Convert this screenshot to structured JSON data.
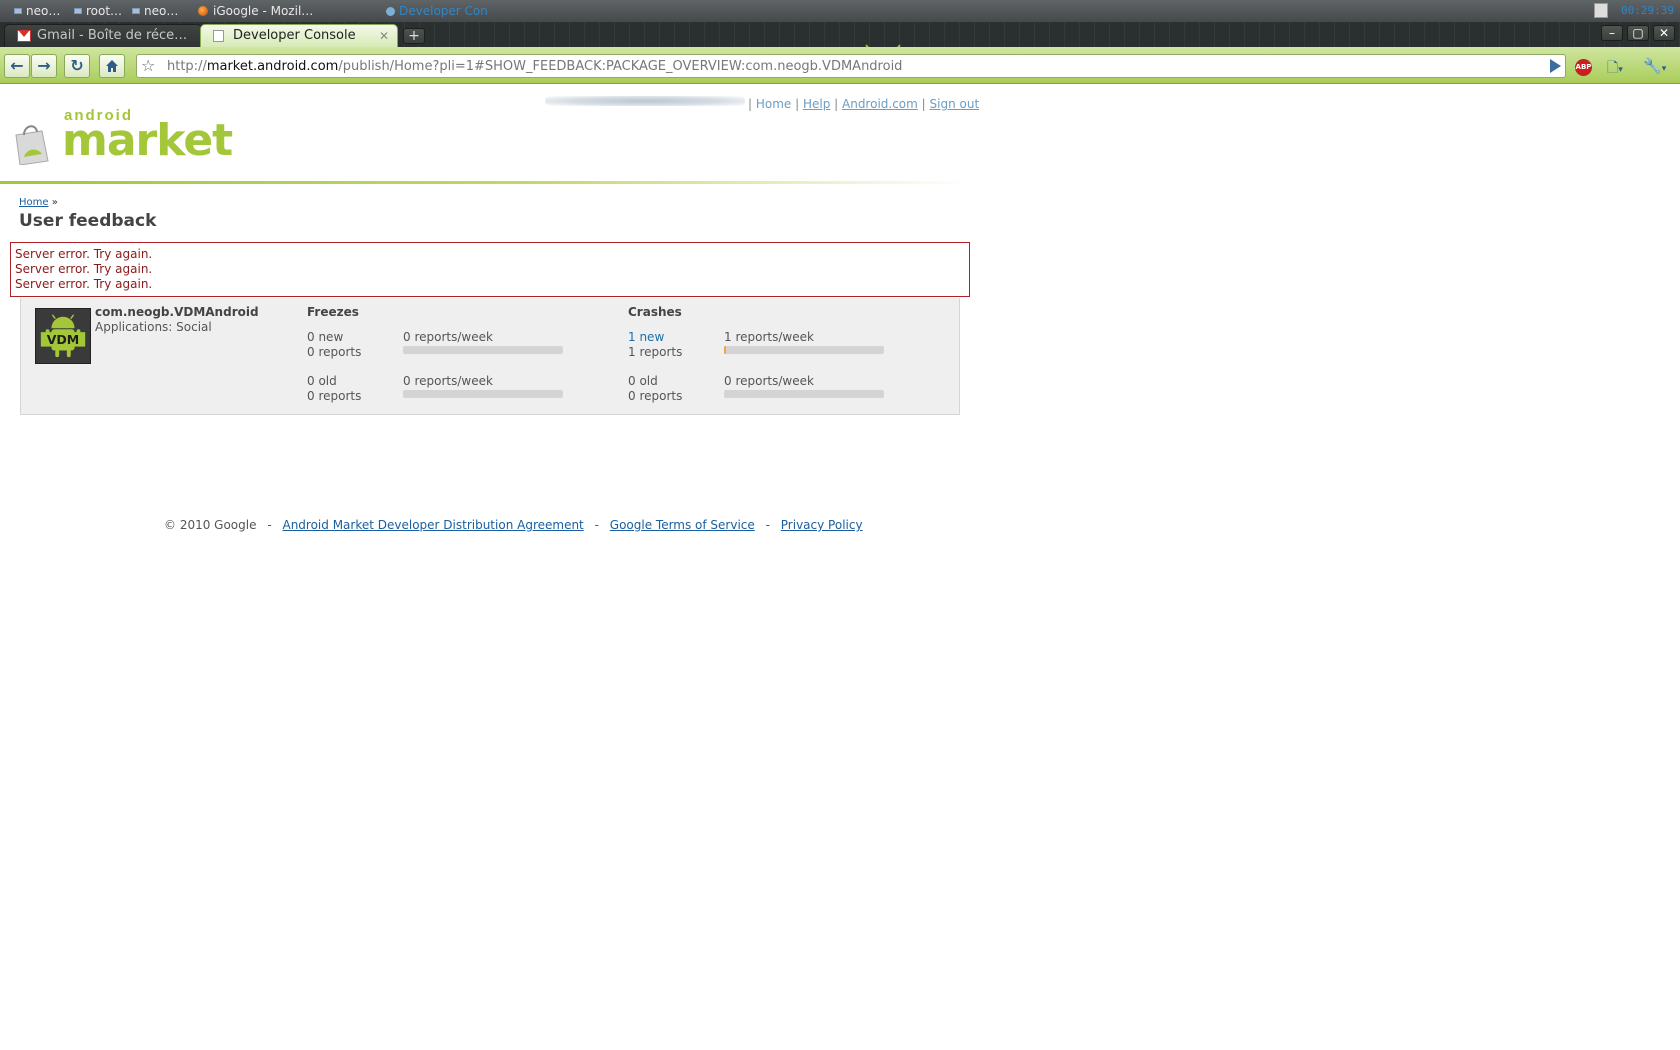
{
  "taskbar": {
    "items": [
      "neo…",
      "root…",
      "neo…",
      "iGoogle - Mozil…",
      "Developer Con"
    ],
    "clock": "00:29:39"
  },
  "browser": {
    "tabs": [
      {
        "label": "Gmail - Boîte de réce…",
        "active": false
      },
      {
        "label": "Developer Console",
        "active": true
      }
    ],
    "new_tab": "+",
    "window_buttons": [
      "–",
      "▢",
      "✕"
    ],
    "url": {
      "scheme": "http://",
      "host": "market.android.com",
      "path": "/publish/Home?pli=1#SHOW_FEEDBACK:PACKAGE_OVERVIEW:com.neogb.VDMAndroid"
    },
    "abp_label": "ABP"
  },
  "header": {
    "logo_small": "android",
    "logo_big": "market",
    "links": {
      "home": "Home",
      "help": "Help",
      "android_com": "Android.com",
      "sign_out": "Sign out"
    }
  },
  "breadcrumb": {
    "home": "Home",
    "sep": "»"
  },
  "page_title": "User feedback",
  "errors": [
    "Server error. Try again.",
    "Server error. Try again.",
    "Server error. Try again."
  ],
  "app": {
    "package": "com.neogb.VDMAndroid",
    "category": "Applications: Social",
    "icon_text": "VDM"
  },
  "freezes": {
    "title": "Freezes",
    "new_count": "0 new",
    "new_reports": "0 reports",
    "new_rate": "0 reports/week",
    "new_bar_fraction": 0,
    "old_count": "0 old",
    "old_reports": "0 reports",
    "old_rate": "0 reports/week",
    "old_bar_fraction": 0
  },
  "crashes": {
    "title": "Crashes",
    "new_count": "1 new",
    "new_reports": "1 reports",
    "new_rate": "1 reports/week",
    "new_bar_fraction": 0.01,
    "old_count": "0 old",
    "old_reports": "0 reports",
    "old_rate": "0 reports/week",
    "old_bar_fraction": 0
  },
  "footer": {
    "copyright": "© 2010 Google",
    "agreement": "Android Market Developer Distribution Agreement",
    "terms": "Google Terms of Service",
    "privacy": "Privacy Policy",
    "sep": "-"
  },
  "colors": {
    "accent": "#a4c639",
    "error": "#b02027",
    "bar_fill": "#f1a33c",
    "link": "#1b5fa0"
  }
}
